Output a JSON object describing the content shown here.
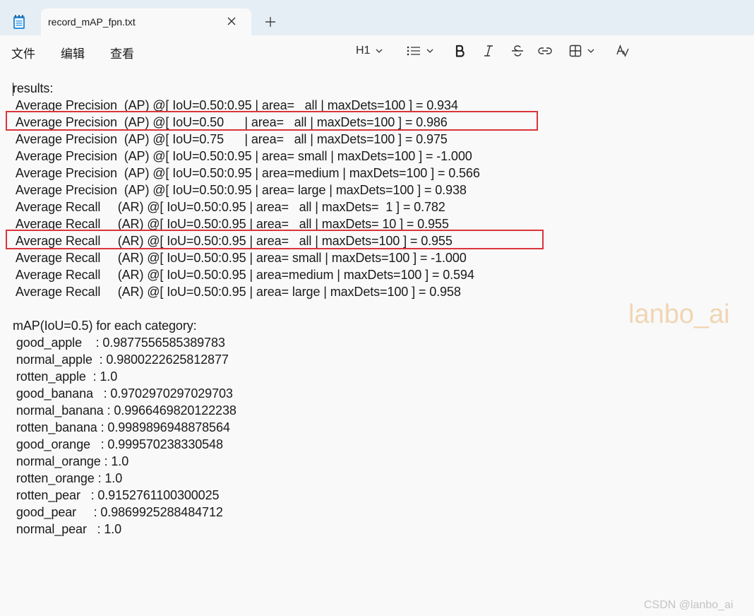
{
  "tab": {
    "title": "record_mAP_fpn.txt"
  },
  "menu": {
    "file": "文件",
    "edit": "编辑",
    "view": "查看"
  },
  "toolbar": {
    "heading": "H1"
  },
  "document": {
    "lines": [
      "results:",
      " Average Precision  (AP) @[ IoU=0.50:0.95 | area=   all | maxDets=100 ] = 0.934",
      " Average Precision  (AP) @[ IoU=0.50      | area=   all | maxDets=100 ] = 0.986",
      " Average Precision  (AP) @[ IoU=0.75      | area=   all | maxDets=100 ] = 0.975",
      " Average Precision  (AP) @[ IoU=0.50:0.95 | area= small | maxDets=100 ] = -1.000",
      " Average Precision  (AP) @[ IoU=0.50:0.95 | area=medium | maxDets=100 ] = 0.566",
      " Average Precision  (AP) @[ IoU=0.50:0.95 | area= large | maxDets=100 ] = 0.938",
      " Average Recall     (AR) @[ IoU=0.50:0.95 | area=   all | maxDets=  1 ] = 0.782",
      " Average Recall     (AR) @[ IoU=0.50:0.95 | area=   all | maxDets= 10 ] = 0.955",
      " Average Recall     (AR) @[ IoU=0.50:0.95 | area=   all | maxDets=100 ] = 0.955",
      " Average Recall     (AR) @[ IoU=0.50:0.95 | area= small | maxDets=100 ] = -1.000",
      " Average Recall     (AR) @[ IoU=0.50:0.95 | area=medium | maxDets=100 ] = 0.594",
      " Average Recall     (AR) @[ IoU=0.50:0.95 | area= large | maxDets=100 ] = 0.958",
      "",
      "mAP(IoU=0.5) for each category:",
      " good_apple    : 0.9877556585389783",
      " normal_apple  : 0.9800222625812877",
      " rotten_apple  : 1.0",
      " good_banana   : 0.9702970297029703",
      " normal_banana : 0.9966469820122238",
      " rotten_banana : 0.9989896948878564",
      " good_orange   : 0.999570238330548",
      " normal_orange : 1.0",
      " rotten_orange : 1.0",
      " rotten_pear   : 0.9152761100300025",
      " good_pear     : 0.9869925288484712",
      " normal_pear   : 1.0"
    ]
  },
  "overlays": {
    "watermark": "lanbo_ai",
    "credit": "CSDN @lanbo_ai",
    "highlight_color": "#d9353b"
  }
}
